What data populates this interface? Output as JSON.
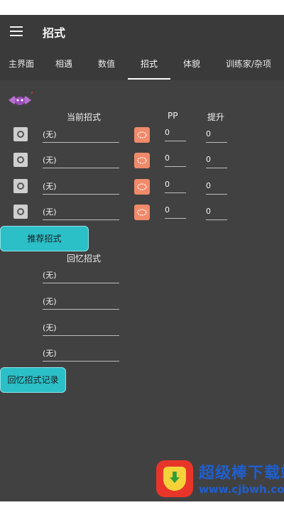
{
  "app_title": "招式",
  "tabs": [
    {
      "label": "主界面"
    },
    {
      "label": "相遇"
    },
    {
      "label": "数值"
    },
    {
      "label": "招式",
      "active": true
    },
    {
      "label": "体貌"
    },
    {
      "label": "训练家/杂项"
    }
  ],
  "current_moves": {
    "header": "当前招式",
    "pp_header": "PP",
    "boost_header": "提升",
    "rows": [
      {
        "move": "(无)",
        "pp": "0",
        "boost": "0"
      },
      {
        "move": "(无)",
        "pp": "0",
        "boost": "0"
      },
      {
        "move": "(无)",
        "pp": "0",
        "boost": "0"
      },
      {
        "move": "(无)",
        "pp": "0",
        "boost": "0"
      }
    ]
  },
  "recommend_button": "推荐招式",
  "relearn_moves": {
    "header": "回忆招式",
    "rows": [
      {
        "move": "(无)"
      },
      {
        "move": "(无)"
      },
      {
        "move": "(无)"
      },
      {
        "move": "(无)"
      }
    ]
  },
  "relearn_record_button": "回忆招式记录",
  "watermark": {
    "title": "超级棒下载站",
    "url": "www.cjbwh.com"
  },
  "colors": {
    "background": "#414141",
    "appbar": "#3a3a3a",
    "accent_teal": "#2bbfc8",
    "type_badge": "#f08a6a"
  }
}
